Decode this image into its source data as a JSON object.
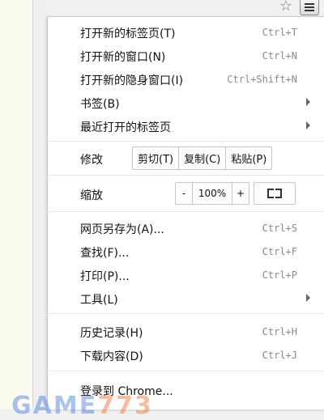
{
  "menu": {
    "items": [
      {
        "label": "打开新的标签页(T)",
        "shortcut": "Ctrl+T"
      },
      {
        "label": "打开新的窗口(N)",
        "shortcut": "Ctrl+N"
      },
      {
        "label": "打开新的隐身窗口(I)",
        "shortcut": "Ctrl+Shift+N"
      },
      {
        "label": "书签(B)"
      },
      {
        "label": "最近打开的标签页"
      },
      {
        "label": "网页另存为(A)...",
        "shortcut": "Ctrl+S"
      },
      {
        "label": "查找(F)...",
        "shortcut": "Ctrl+F"
      },
      {
        "label": "打印(P)...",
        "shortcut": "Ctrl+P"
      },
      {
        "label": "工具(L)"
      },
      {
        "label": "历史记录(H)",
        "shortcut": "Ctrl+H"
      },
      {
        "label": "下载内容(D)",
        "shortcut": "Ctrl+J"
      },
      {
        "label": "登录到 Chrome..."
      }
    ],
    "edit": {
      "label": "修改",
      "cut": "剪切(T)",
      "copy": "复制(C)",
      "paste": "粘贴(P)"
    },
    "zoom": {
      "label": "缩放",
      "minus": "-",
      "level": "100%",
      "plus": "+"
    }
  },
  "watermark": {
    "letters": "GAME",
    "digits": "773"
  },
  "icons": {
    "bookmark": "star-icon",
    "menu": "hamburger-menu-icon",
    "fullscreen": "fullscreen-icon",
    "submenu": "chevron-right-icon"
  }
}
